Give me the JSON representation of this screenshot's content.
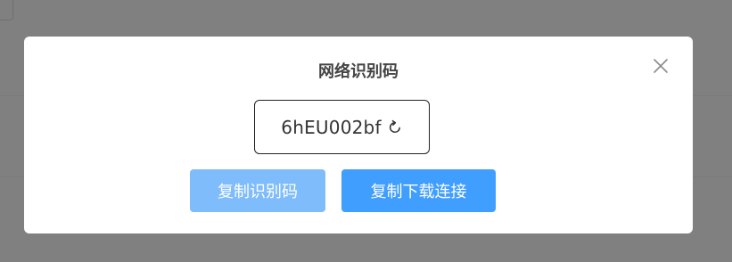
{
  "dialog": {
    "title": "网络识别码",
    "code": "6hEU002bf",
    "copy_code_label": "复制识别码",
    "copy_link_label": "复制下载连接",
    "close_icon": "close-icon",
    "refresh_icon": "refresh-icon"
  },
  "colors": {
    "overlay": "#808080",
    "dialog_bg": "#ffffff",
    "primary_light": "#7fbcfb",
    "primary": "#409efe",
    "title_text": "#444444"
  }
}
